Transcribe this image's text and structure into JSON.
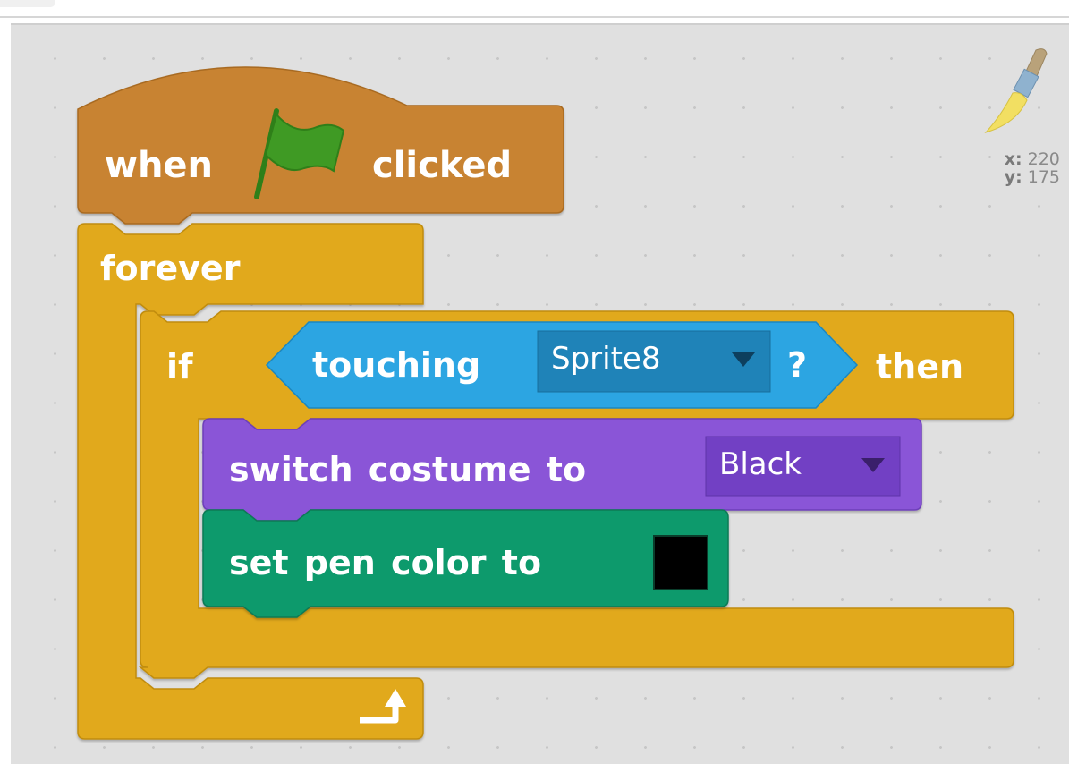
{
  "script": {
    "hat": {
      "before": "when",
      "after": "clicked",
      "icon": "green-flag-icon"
    },
    "forever": {
      "label": "forever",
      "loop_icon": "loop-arrow-icon"
    },
    "if": {
      "if_label": "if",
      "then_label": "then",
      "condition": {
        "label": "touching",
        "menu_value": "Sprite8",
        "question": "?"
      }
    },
    "switch_costume": {
      "label": "switch costume to",
      "menu_value": "Black"
    },
    "set_pen_color": {
      "label": "set pen color to",
      "color": "#000000"
    }
  },
  "sprite_info": {
    "x_label": "x:",
    "x_value": "220",
    "y_label": "y:",
    "y_value": "175",
    "icon": "paintbrush-icon"
  },
  "colors": {
    "events": "#c88330",
    "control": "#e1a91a",
    "sensing": "#2ca5e2",
    "looks": "#8a55d7",
    "pen": "#0e9a6c",
    "workspace": "#e0e0e0"
  }
}
